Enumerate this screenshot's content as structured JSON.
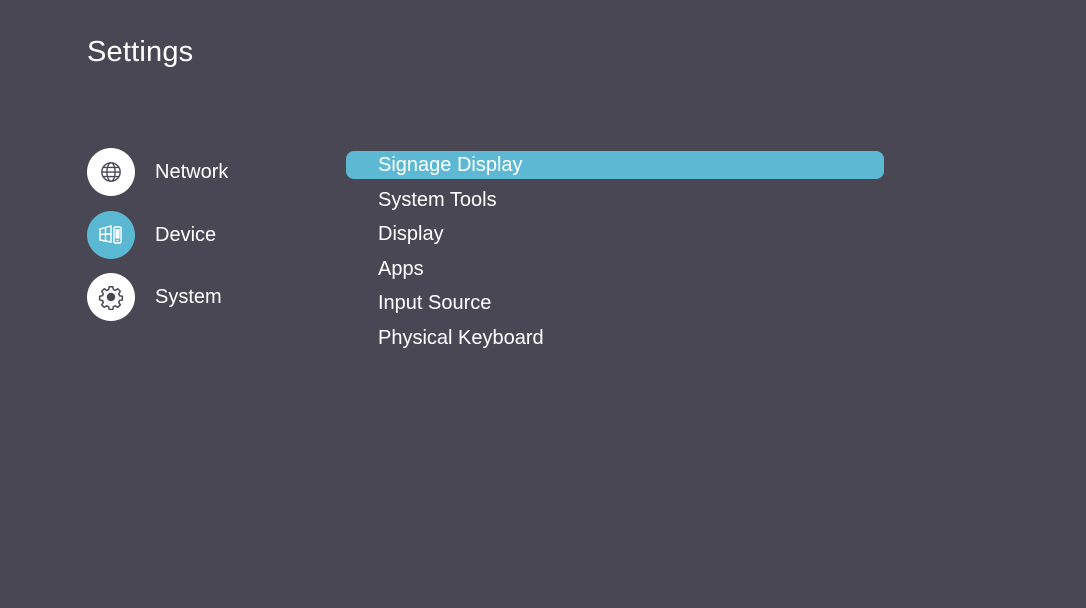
{
  "header": {
    "title": "Settings"
  },
  "categories": [
    {
      "label": "Network",
      "icon": "globe-icon",
      "active": false
    },
    {
      "label": "Device",
      "icon": "device-icon",
      "active": true
    },
    {
      "label": "System",
      "icon": "gear-icon",
      "active": false
    }
  ],
  "submenu": {
    "selected_index": 0,
    "items": [
      {
        "label": "Signage Display"
      },
      {
        "label": "System Tools"
      },
      {
        "label": "Display"
      },
      {
        "label": "Apps"
      },
      {
        "label": "Input Source"
      },
      {
        "label": "Physical Keyboard"
      }
    ]
  },
  "colors": {
    "background": "#4a4754",
    "accent": "#5db9d3",
    "text": "#ffffff",
    "icon_circle": "#ffffff"
  }
}
